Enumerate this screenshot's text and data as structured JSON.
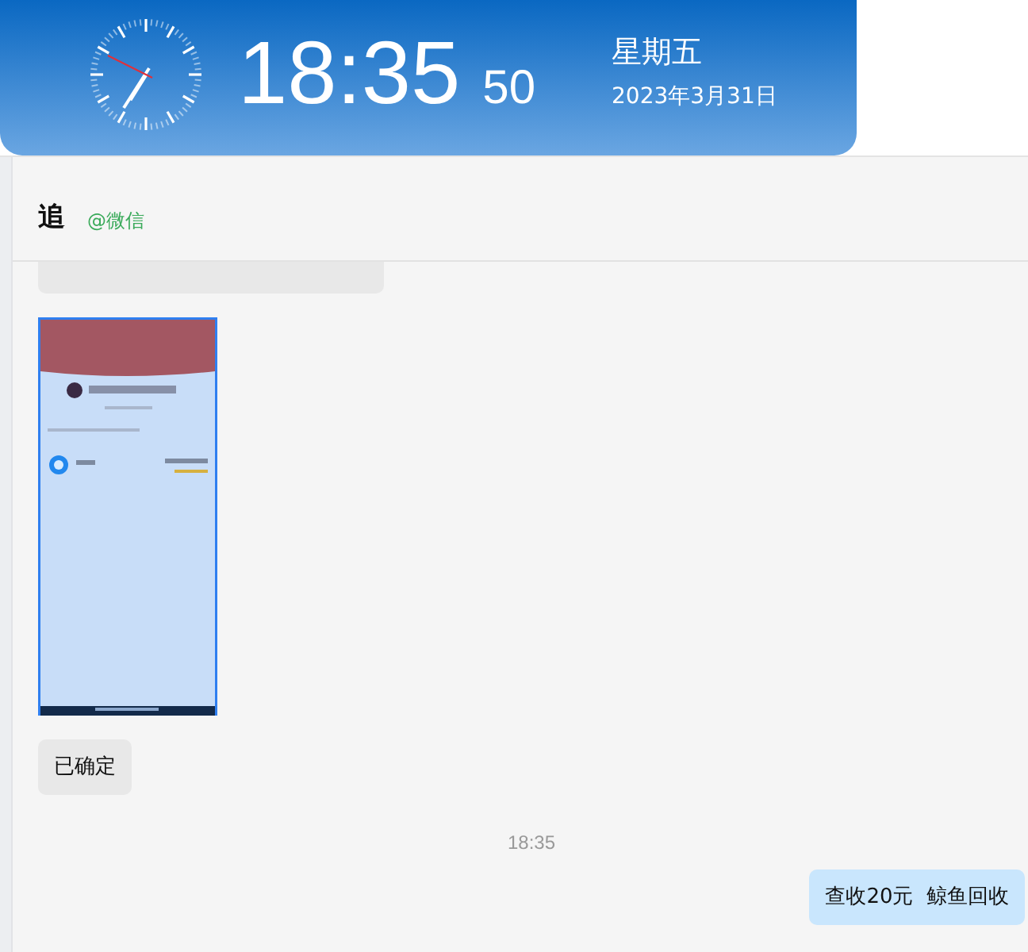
{
  "clock": {
    "time": "18:35",
    "seconds": "50",
    "weekday": "星期五",
    "date": "2023年3月31日"
  },
  "chat": {
    "title": "追",
    "source": "@微信",
    "messages": [
      {
        "kind": "clipped",
        "outgoing": false
      },
      {
        "kind": "picture",
        "outgoing": false
      },
      {
        "kind": "text",
        "outgoing": false,
        "text": "已确定"
      },
      {
        "kind": "time",
        "text": "18:35"
      },
      {
        "kind": "text",
        "outgoing": true,
        "text": "查收20元  鲸鱼回收"
      }
    ]
  }
}
